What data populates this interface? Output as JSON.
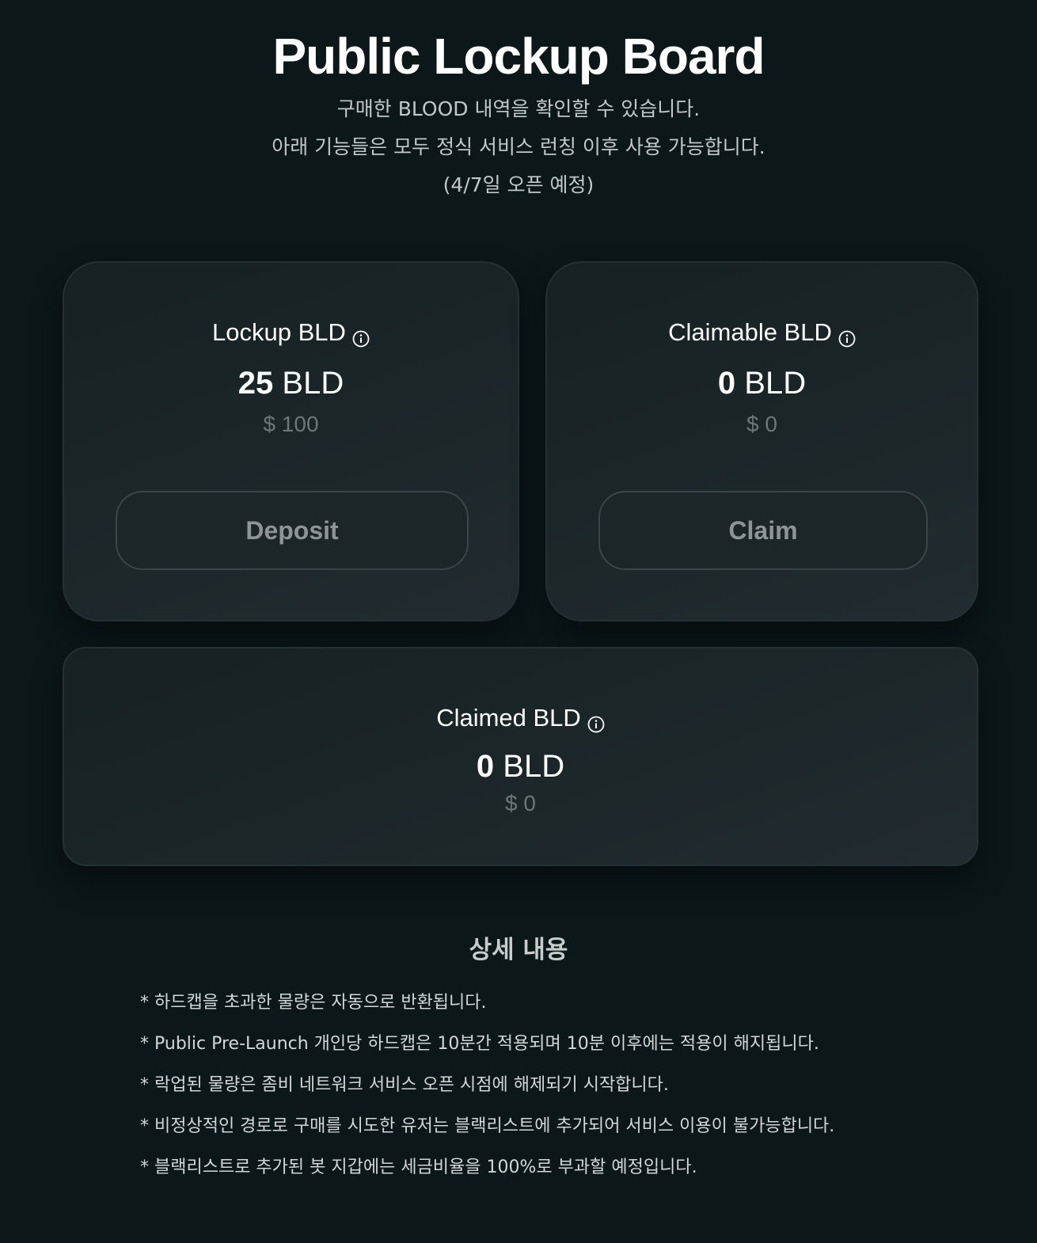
{
  "header": {
    "title": "Public Lockup Board",
    "subtitle_lines": [
      "구매한 BLOOD 내역을 확인할 수 있습니다.",
      "아래 기능들은 모두 정식 서비스 런칭 이후 사용 가능합니다.",
      "(4/7일 오픈 예정)"
    ]
  },
  "cards": {
    "lockup": {
      "title": "Lockup BLD",
      "amount": "25",
      "unit": "BLD",
      "usd": "$ 100",
      "button_label": "Deposit"
    },
    "claimable": {
      "title": "Claimable BLD",
      "amount": "0",
      "unit": "BLD",
      "usd": "$ 0",
      "button_label": "Claim"
    },
    "claimed": {
      "title": "Claimed BLD",
      "amount": "0",
      "unit": "BLD",
      "usd": "$ 0"
    }
  },
  "details": {
    "title": "상세 내용",
    "items": [
      "* 하드캡을 초과한 물량은 자동으로 반환됩니다.",
      "* Public Pre-Launch 개인당 하드캡은 10분간 적용되며 10분 이후에는 적용이 해지됩니다.",
      "* 락업된 물량은 좀비 네트워크 서비스 오픈 시점에 해제되기 시작합니다.",
      "* 비정상적인 경로로 구매를 시도한 유저는 블랙리스트에 추가되어 서비스 이용이 불가능합니다.",
      "* 블랙리스트로 추가된 봇 지갑에는 세금비율을 100%로 부과할 예정입니다."
    ]
  },
  "colors": {
    "background": "#0b1719",
    "card_border": "#243033",
    "muted_text": "#6e7679",
    "button_text": "#8f9496"
  },
  "icons": {
    "info": "info-circle-icon"
  }
}
